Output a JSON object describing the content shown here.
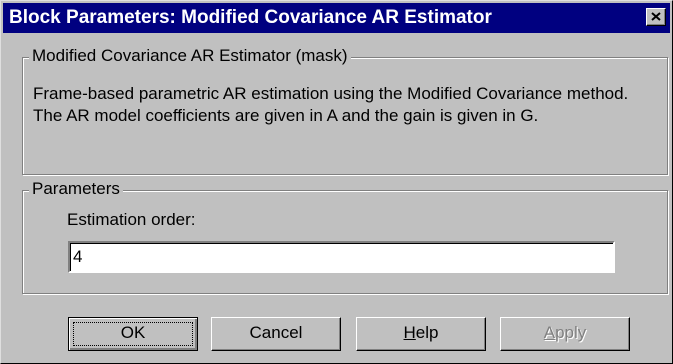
{
  "dialog": {
    "title": "Block Parameters: Modified Covariance AR Estimator"
  },
  "mask_group": {
    "legend": "Modified Covariance AR Estimator (mask)",
    "description": "Frame-based parametric AR estimation using the Modified Covariance method. The AR model coefficients are given in A and the gain is given in G."
  },
  "parameters_group": {
    "legend": "Parameters",
    "estimation_order_label": "Estimation order:",
    "estimation_order_value": "4"
  },
  "buttons": {
    "ok": "OK",
    "cancel": "Cancel",
    "help_prefix": "H",
    "help_rest": "elp",
    "apply_prefix": "A",
    "apply_rest": "pply"
  }
}
